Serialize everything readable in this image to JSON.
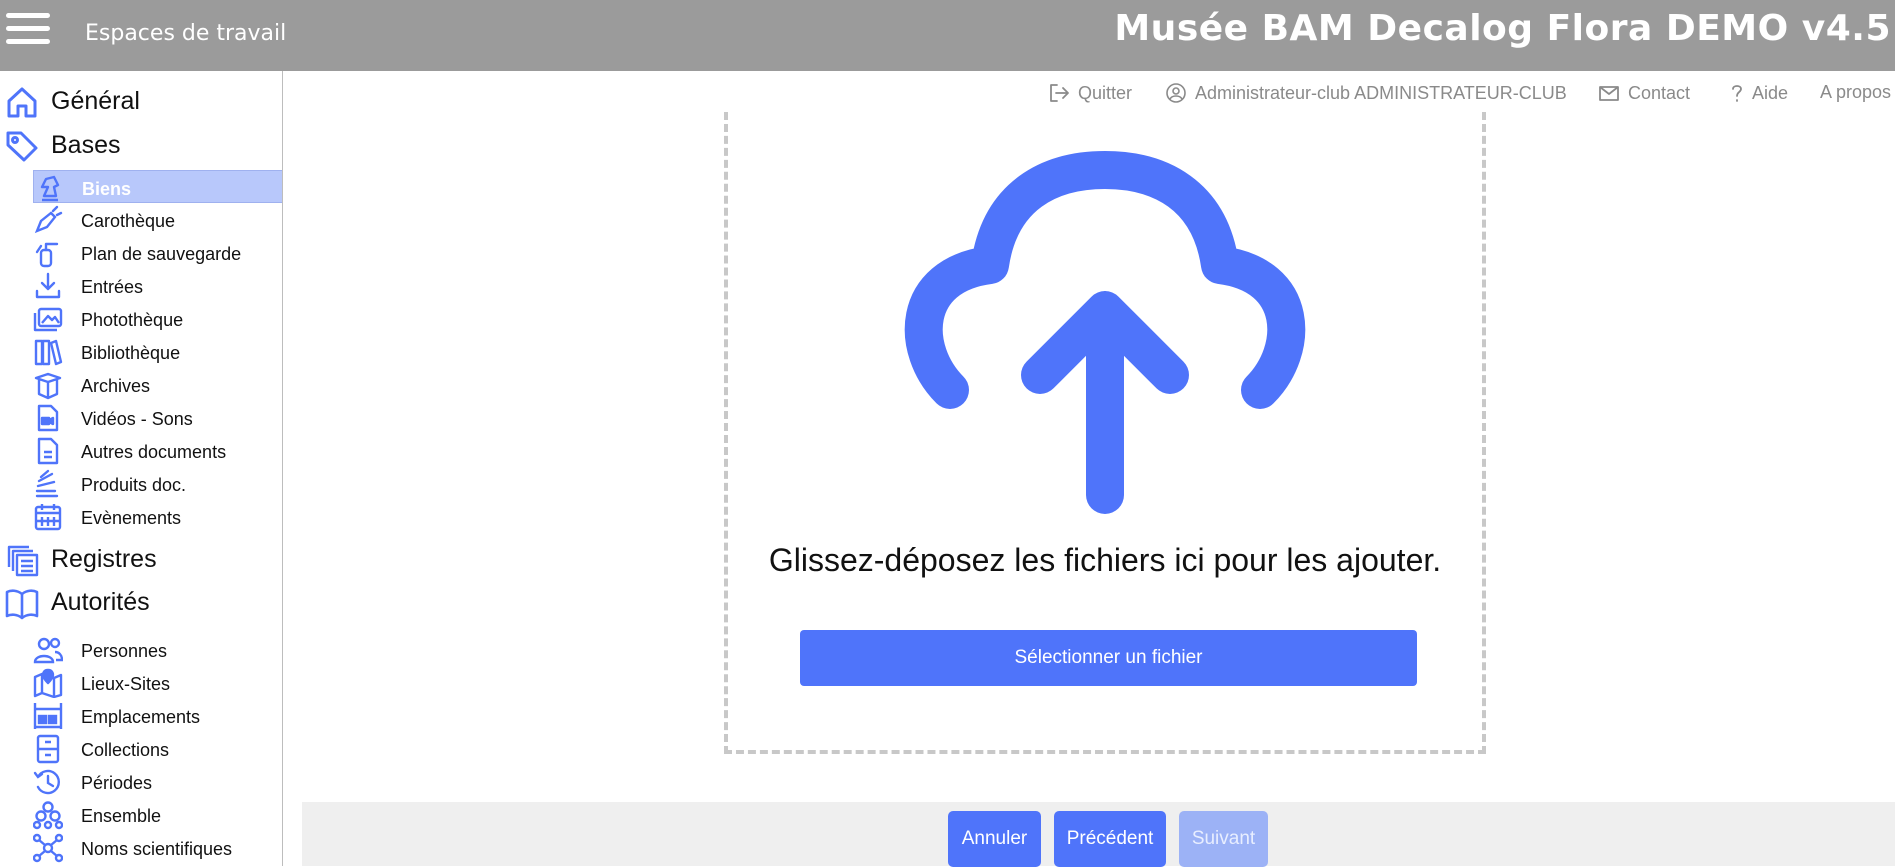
{
  "header": {
    "workspaces_label": "Espaces de travail",
    "title": "Musée BAM Decalog Flora DEMO v4.5"
  },
  "subnav": {
    "quit": "Quitter",
    "user": "Administrateur-club ADMINISTRATEUR-CLUB",
    "contact": "Contact",
    "help": "Aide",
    "about": "A propos"
  },
  "sidebar": {
    "general": "Général",
    "bases": "Bases",
    "bases_items": [
      {
        "label": "Biens",
        "icon": "chess-knight-icon"
      },
      {
        "label": "Carothèque",
        "icon": "brush-icon"
      },
      {
        "label": "Plan de sauvegarde",
        "icon": "fire-extinguisher-icon"
      },
      {
        "label": "Entrées",
        "icon": "download-icon"
      },
      {
        "label": "Photothèque",
        "icon": "images-icon"
      },
      {
        "label": "Bibliothèque",
        "icon": "books-icon"
      },
      {
        "label": "Archives",
        "icon": "box-icon"
      },
      {
        "label": "Vidéos - Sons",
        "icon": "video-file-icon"
      },
      {
        "label": "Autres documents",
        "icon": "document-icon"
      },
      {
        "label": "Produits doc.",
        "icon": "stack-icon"
      },
      {
        "label": "Evènements",
        "icon": "calendar-icon"
      }
    ],
    "registres": "Registres",
    "autorites": "Autorités",
    "autorites_items": [
      {
        "label": "Personnes",
        "icon": "people-icon"
      },
      {
        "label": "Lieux-Sites",
        "icon": "map-pin-icon"
      },
      {
        "label": "Emplacements",
        "icon": "shelf-icon"
      },
      {
        "label": "Collections",
        "icon": "cabinet-icon"
      },
      {
        "label": "Périodes",
        "icon": "history-icon"
      },
      {
        "label": "Ensemble",
        "icon": "group-icon"
      },
      {
        "label": "Noms scientifiques",
        "icon": "network-icon"
      }
    ]
  },
  "upload": {
    "drop_text": "Glissez-déposez les fichiers ici pour les ajouter.",
    "select_label": "Sélectionner un fichier"
  },
  "footer": {
    "cancel": "Annuler",
    "previous": "Précédent",
    "next": "Suivant"
  },
  "colors": {
    "accent": "#4f74fa",
    "header_bg": "#9b9b9b",
    "active_item_bg": "#b8c8fb"
  }
}
